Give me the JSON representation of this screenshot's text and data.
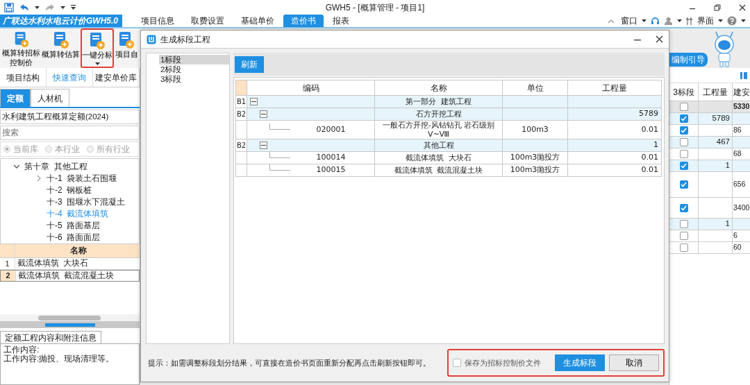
{
  "title_bar": {
    "title": "GWH5 - [概算管理 - 项目1]"
  },
  "menu_bar": {
    "app_menu": "广联达水利水电云计价GWH5.0",
    "tabs": [
      {
        "label": "项目信息",
        "selected": false
      },
      {
        "label": "取费设置",
        "selected": false
      },
      {
        "label": "基础单价",
        "selected": false
      },
      {
        "label": "造价书",
        "selected": true
      },
      {
        "label": "报表",
        "selected": false
      }
    ],
    "window_menu": "窗口",
    "interface_menu": "界面"
  },
  "ribbon": {
    "buttons": [
      {
        "label": "概算转招标控制价",
        "highlighted": false,
        "dropdown": false
      },
      {
        "label": "概算转估算",
        "highlighted": false,
        "dropdown": false
      },
      {
        "label": "一键分标",
        "highlighted": true,
        "dropdown": true
      },
      {
        "label": "项目自",
        "highlighted": false,
        "dropdown": false
      }
    ]
  },
  "left_panel": {
    "tabs": [
      {
        "label": "项目结构",
        "selected": false
      },
      {
        "label": "快速查询",
        "selected": true
      },
      {
        "label": "建安单价库",
        "selected": false
      }
    ],
    "subtabs": [
      {
        "label": "定额",
        "selected": true
      },
      {
        "label": "人材机",
        "selected": false
      }
    ],
    "library": "水利建筑工程概算定额(2024)",
    "search": {
      "placeholder": "搜索"
    },
    "scopes": [
      {
        "label": "当前库",
        "selected": true,
        "disabled": true
      },
      {
        "label": "本行业",
        "selected": false,
        "disabled": true
      },
      {
        "label": "所有行业",
        "selected": false,
        "disabled": true
      }
    ],
    "tree": [
      {
        "label": "第十章  其他工程",
        "expanded": true,
        "selected": false,
        "children": [
          {
            "label": "十-1  袋装土石围堰",
            "expanded": false,
            "selected": false
          },
          {
            "label": "十-2  钢板桩",
            "selected": false
          },
          {
            "label": "十-3  围堰水下混凝土",
            "selected": false
          },
          {
            "label": "十-4  截流体填筑",
            "selected": true
          },
          {
            "label": "十-5  路面基层",
            "selected": false
          },
          {
            "label": "十-6  路面面层",
            "selected": false
          }
        ]
      }
    ],
    "table": {
      "columns": [
        "名称"
      ],
      "rows": [
        {
          "number": "1",
          "name": "截流体填筑  大块石",
          "selected": false
        },
        {
          "number": "2",
          "name": "截流体填筑  截流混凝土块",
          "selected": true
        }
      ]
    },
    "info": {
      "tab": "定额工程内容和附注信息",
      "lines": [
        "工作内容:",
        "工作内容:抛投、现场清理等。"
      ]
    }
  },
  "dialog": {
    "title": "生成标段工程",
    "sections": [
      {
        "label": "1标段",
        "selected": true
      },
      {
        "label": "2标段",
        "selected": false
      },
      {
        "label": "3标段",
        "selected": false
      }
    ],
    "refresh_button": "刷新",
    "table": {
      "columns": [
        "编码",
        "名称",
        "单位",
        "工程量"
      ],
      "rows": [
        {
          "row_header": "B1",
          "kind": "group",
          "expanded": true,
          "name": "第一部分  建筑工程",
          "children": [
            {
              "row_header": "B2",
              "kind": "group",
              "expanded": true,
              "name": "石方开挖工程",
              "quantity": "5789",
              "children": [
                {
                  "kind": "item",
                  "code": "020001",
                  "name": "一般石方开挖-风钻钻孔 岩石级别Ⅴ~Ⅷ",
                  "unit": "100m3",
                  "quantity": "0.01"
                }
              ]
            },
            {
              "row_header": "B2",
              "kind": "group",
              "expanded": true,
              "name": "其他工程",
              "quantity": "1",
              "children": [
                {
                  "kind": "item",
                  "code": "100014",
                  "name": "截流体填筑  大块石",
                  "unit": "100m3抛投方",
                  "quantity": "0.01"
                },
                {
                  "kind": "item",
                  "code": "100015",
                  "name": "截流体填筑  截流混凝土块",
                  "unit": "100m3抛投方",
                  "quantity": "0.01"
                }
              ]
            }
          ]
        }
      ]
    },
    "hint": "提示：如需调整标段划分结果，可直接在造价书页面重新分配再点击刷新按钮即可。",
    "save_option": {
      "label": "保存为招标控制价文件",
      "checked": false
    },
    "highlighted": true,
    "buttons": [
      {
        "label": "生成标段",
        "kind": "primary"
      },
      {
        "label": "取消",
        "kind": "secondary"
      }
    ]
  },
  "right_panel": {
    "guide_button": "编制引导",
    "columns": [
      "3标段",
      "工程量",
      "建安"
    ],
    "rows": [
      {
        "kind": "total",
        "checked": false,
        "amount": "5330"
      },
      {
        "kind": "group",
        "checked": true,
        "quantity": "5789"
      },
      {
        "kind": "item",
        "checked": true,
        "amount": "86"
      },
      {
        "kind": "group",
        "checked": false,
        "quantity": "467"
      },
      {
        "kind": "item",
        "checked": false,
        "amount": "68"
      },
      {
        "kind": "group",
        "checked": true,
        "quantity": "1"
      },
      {
        "kind": "item",
        "checked": true,
        "amount": "656"
      },
      {
        "kind": "item",
        "checked": true,
        "amount": "3400"
      },
      {
        "kind": "group",
        "checked": false,
        "quantity": "1"
      },
      {
        "kind": "item",
        "checked": false,
        "amount": "6"
      },
      {
        "kind": "item",
        "checked": false,
        "amount": "60"
      }
    ]
  }
}
